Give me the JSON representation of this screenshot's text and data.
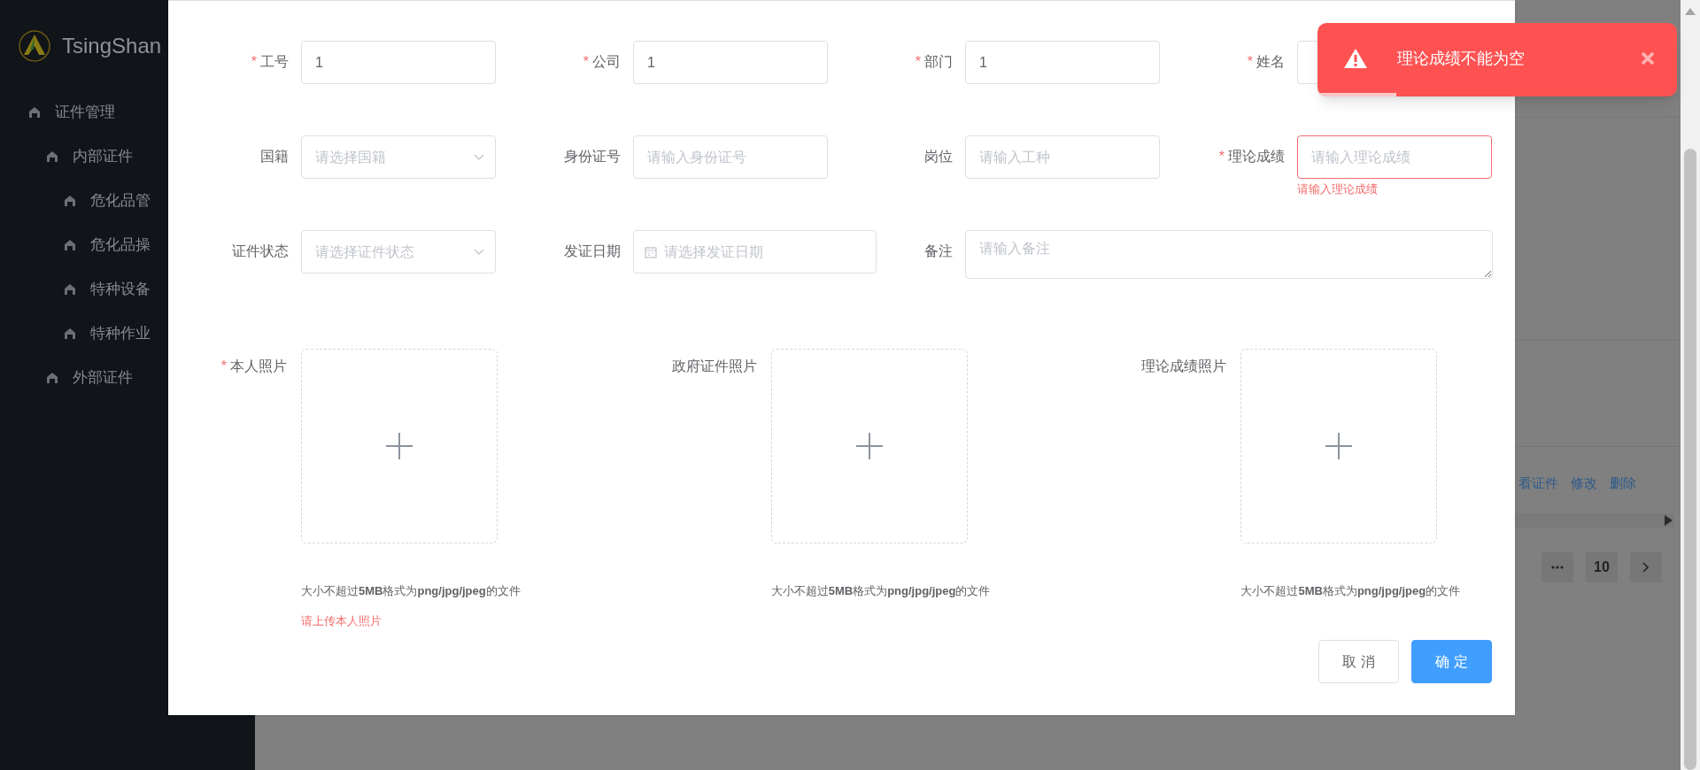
{
  "sidebar": {
    "brand": "TsingShan",
    "menu": [
      {
        "label": "证件管理",
        "children": [
          {
            "label": "内部证件",
            "children": [
              {
                "label": "危化品管"
              },
              {
                "label": "危化品操"
              },
              {
                "label": "特种设备"
              },
              {
                "label": "特种作业"
              }
            ]
          },
          {
            "label": "外部证件"
          }
        ]
      }
    ]
  },
  "background_page": {
    "row_actions": [
      "看证件",
      "修改",
      "删除"
    ],
    "last_page": "10"
  },
  "dialog": {
    "fields": [
      {
        "kind": "input",
        "required_mark": "*",
        "label": "工号",
        "value": "1"
      },
      {
        "kind": "input",
        "required_mark": "*",
        "label": "公司",
        "value": "1"
      },
      {
        "kind": "input",
        "required_mark": "*",
        "label": "部门",
        "value": "1"
      },
      {
        "kind": "input",
        "required_mark": "*",
        "label": "姓名"
      },
      {
        "kind": "select",
        "label": "国籍",
        "placeholder": "请选择国籍"
      },
      {
        "kind": "input",
        "label": "身份证号",
        "placeholder": "请输入身份证号"
      },
      {
        "kind": "input",
        "label": "岗位",
        "placeholder": "请输入工种"
      },
      {
        "kind": "input",
        "required_mark": "*",
        "label": "理论成绩",
        "placeholder": "请输入理论成绩",
        "error": "请输入理论成绩"
      },
      {
        "kind": "select",
        "label": "证件状态",
        "placeholder": "请选择证件状态"
      },
      {
        "kind": "date",
        "label": "发证日期",
        "placeholder": "请选择发证日期"
      },
      {
        "kind": "textarea",
        "label": "备注",
        "placeholder": "请输入备注"
      }
    ],
    "uploads": [
      {
        "required_mark": "*",
        "label": "本人照片",
        "hint": "大小不超过**5MB**格式为**png/jpg/jpeg**的文件",
        "error": "请上传本人照片"
      },
      {
        "label": "政府证件照片",
        "hint": "大小不超过**5MB**格式为**png/jpg/jpeg**的文件"
      },
      {
        "label": "理论成绩照片",
        "hint": "大小不超过**5MB**格式为**png/jpg/jpeg**的文件"
      }
    ],
    "buttons": [
      {
        "kind": "secondary",
        "label": "取 消"
      },
      {
        "kind": "primary",
        "label": "确 定"
      }
    ]
  },
  "notification": {
    "message": "理论成绩不能为空",
    "level": 0.22
  }
}
